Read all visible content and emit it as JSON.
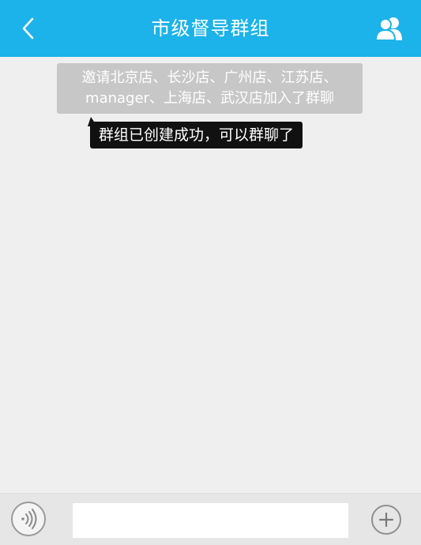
{
  "header": {
    "title": "市级督导群组",
    "back_icon": "back-arrow-icon",
    "members_icon": "group-members-icon",
    "background_color": "#1cb2ea"
  },
  "chat": {
    "notice_text": "邀请北京店、长沙店、广州店、江苏店、manager、上海店、武汉店加入了群聊",
    "message_text": "群组已创建成功，可以群聊了"
  },
  "input_bar": {
    "voice_icon": "voice-icon",
    "message_value": "",
    "plus_icon": "plus-icon"
  }
}
